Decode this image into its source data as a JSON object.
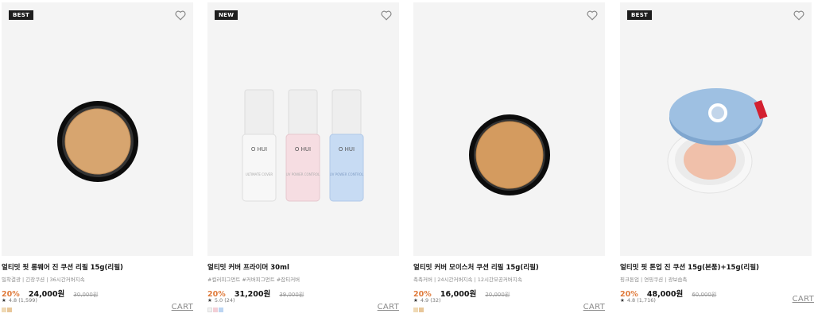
{
  "products": [
    {
      "badge": "BEST",
      "title": "얼티밋 핏 롱웨어 진 쿠션 리필 15g(리필)",
      "tags": "밀착결광 | 긴장쿠션 | 36시간커버지속",
      "discount": "20%",
      "price": "24,000원",
      "original_price": "30,000원",
      "rating": "4.8",
      "reviews": "(1,599)",
      "swatches": [
        "#efd9b5",
        "#e8c79a"
      ],
      "cart_label": "CART"
    },
    {
      "badge": "NEW",
      "title": "얼티밋 커버 프라이머 30ml",
      "tags": "#컬러피그먼트 #커버피그먼트 #잡티커버",
      "discount": "20%",
      "price": "31,200원",
      "original_price": "39,000원",
      "rating": "5.0",
      "reviews": "(24)",
      "swatches": [
        "#f1f1f1",
        "#f3cfd6",
        "#bcd5f2"
      ],
      "cart_label": "CART",
      "bottle_labels": [
        "O HUI",
        "O HUI",
        "O HUI"
      ]
    },
    {
      "badge": "",
      "title": "얼티밋 커버 모이스처 쿠션 리필 15g(리필)",
      "tags": "촉촉커버 | 24시간커버지속 | 12시간모공커버지속",
      "discount": "20%",
      "price": "16,000원",
      "original_price": "20,000원",
      "rating": "4.9",
      "reviews": "(32)",
      "swatches": [
        "#efd9b5",
        "#e8c79a"
      ],
      "cart_label": "CART"
    },
    {
      "badge": "BEST",
      "title": "얼티밋 핏 톤업 진 쿠션 15g(본품)+15g(리필)",
      "tags": "핑크톤업 | 연핑쿠션 | 광보습촉",
      "discount": "20%",
      "price": "48,000원",
      "original_price": "60,000원",
      "rating": "4.8",
      "reviews": "(1,716)",
      "swatches": [],
      "cart_label": "CART"
    }
  ],
  "colors": {
    "accent_discount": "#e07b3c",
    "badge_bg": "#1e1e1e",
    "thumb_bg": "#f4f4f4"
  }
}
